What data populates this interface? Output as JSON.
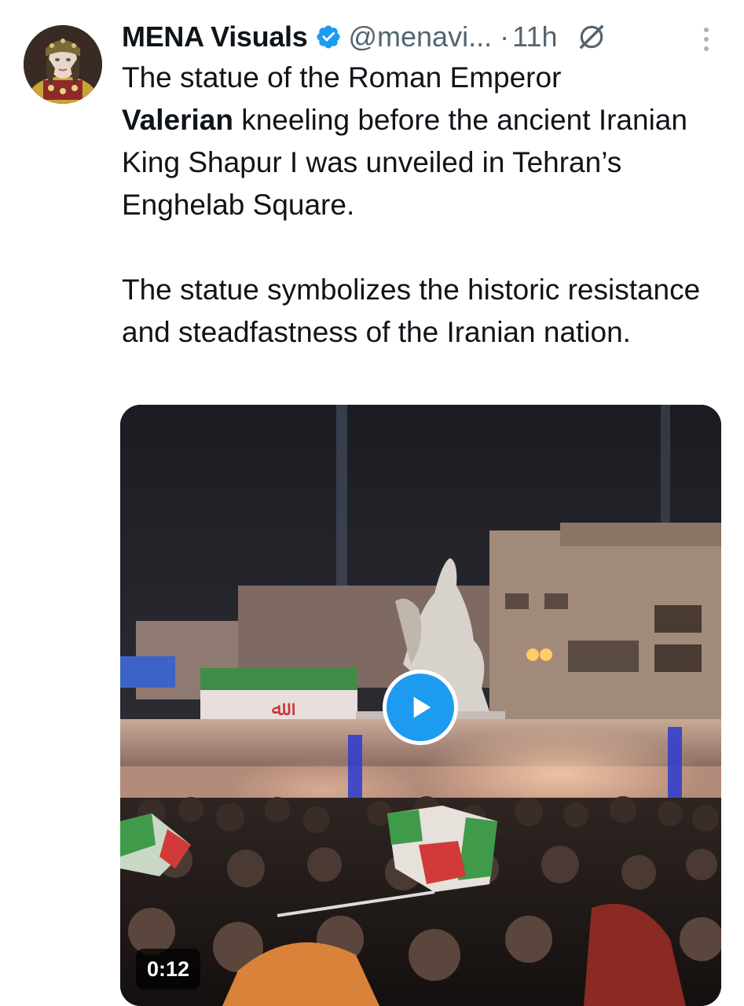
{
  "tweet": {
    "author": {
      "display_name": "MENA Visuals",
      "handle": "@menavi...",
      "verified": true,
      "avatar_icon": "avatar-portrait"
    },
    "separator": "·",
    "time": "11h",
    "text": {
      "line1_prefix": "The statue of the Roman Emperor",
      "bold_word": "Valerian",
      "line1_suffix": " kneeling before the ancient Iranian King Shapur I was unveiled in Tehran’s Enghelab Square.",
      "paragraph2": "The statue symbolizes the historic resistance and steadfastness of the Iranian nation."
    },
    "media": {
      "type": "video",
      "duration": "0:12",
      "play_icon": "play-icon"
    }
  },
  "colors": {
    "text_primary": "#0f1419",
    "text_secondary": "#536471",
    "verified_blue": "#1d9bf0",
    "play_button": "#1d9bf0"
  }
}
